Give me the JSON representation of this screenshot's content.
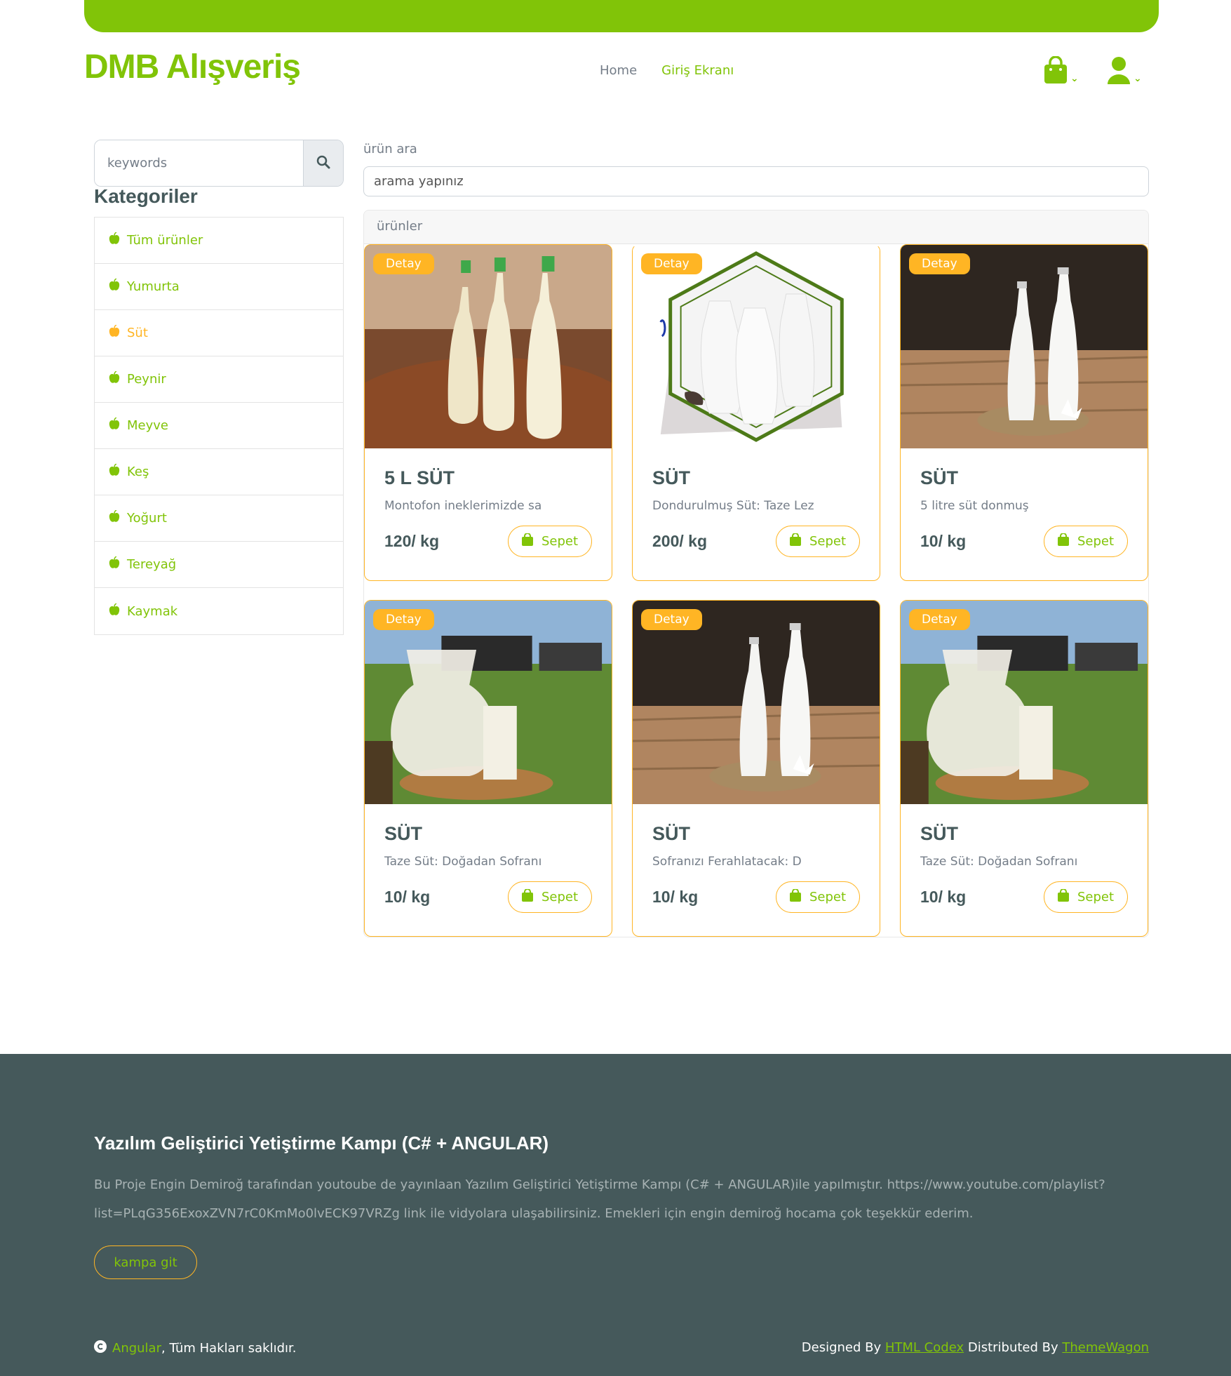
{
  "header": {
    "brand": "DMB Alışveriş",
    "nav": [
      {
        "label": "Home"
      },
      {
        "label": "Giriş Ekranı"
      }
    ],
    "colors": {
      "accent": "#81c408",
      "secondary": "#ffb524",
      "dark": "#45595b"
    }
  },
  "sidebar": {
    "search_placeholder": "keywords",
    "categories_title": "Kategoriler",
    "categories": [
      {
        "label": "Tüm ürünler"
      },
      {
        "label": "Yumurta"
      },
      {
        "label": "Süt"
      },
      {
        "label": "Peynir"
      },
      {
        "label": "Meyve"
      },
      {
        "label": "Keş"
      },
      {
        "label": "Yoğurt"
      },
      {
        "label": "Tereyağ"
      },
      {
        "label": "Kaymak"
      }
    ]
  },
  "main": {
    "search_label": "ürün ara",
    "search_placeholder": "arama yapınız",
    "products_header": "ürünler",
    "products": [
      {
        "badge": "Detay",
        "title": "5 L SÜT",
        "desc": "Montofon ineklerimizde sa",
        "price": "120/ kg",
        "button": "Sepet"
      },
      {
        "badge": "Detay",
        "title": "SÜT",
        "desc": "Dondurulmuş Süt: Taze Lez",
        "price": "200/ kg",
        "button": "Sepet"
      },
      {
        "badge": "Detay",
        "title": "SÜT",
        "desc": "5 litre süt donmuş",
        "price": "10/ kg",
        "button": "Sepet"
      },
      {
        "badge": "Detay",
        "title": "SÜT",
        "desc": "Taze Süt: Doğadan Sofranı",
        "price": "10/ kg",
        "button": "Sepet"
      },
      {
        "badge": "Detay",
        "title": "SÜT",
        "desc": "Sofranızı Ferahlatacak: D",
        "price": "10/ kg",
        "button": "Sepet"
      },
      {
        "badge": "Detay",
        "title": "SÜT",
        "desc": "Taze Süt: Doğadan Sofranı",
        "price": "10/ kg",
        "button": "Sepet"
      }
    ]
  },
  "footer": {
    "title": "Yazılım Geliştirici Yetiştirme Kampı (C# + ANGULAR)",
    "text_line1": "Bu Proje Engin Demiroğ tarafından youtoube de yayınlaan Yazılım Geliştirici Yetiştirme Kampı (C# + ANGULAR)ile yapılmıştır. https://www.youtube.com/playlist?",
    "text_line2": "list=PLqG356ExoxZVN7rC0KmMo0lvECK97VRZg link ile vidyolara ulaşabilirsiniz. Emekleri için engin demiroğ hocama çok teşekkür ederim.",
    "button": "kampa git",
    "copyright_link": "Angular",
    "copyright_text": ", Tüm Hakları saklıdır.",
    "designed_by": "Designed By",
    "designed_link": "HTML Codex",
    "distributed_by": "Distributed By",
    "distributed_link": "ThemeWagon"
  }
}
